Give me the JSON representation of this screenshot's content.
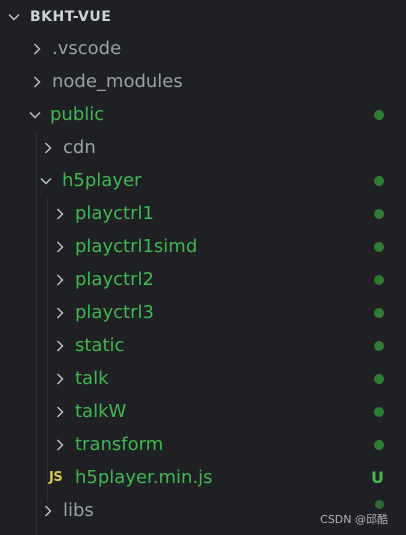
{
  "explorer": {
    "root": {
      "label": "BKHT-VUE"
    },
    "items": [
      {
        "label": ".vscode",
        "color": "#9aa0a6"
      },
      {
        "label": "node_modules",
        "color": "#9aa0a6"
      },
      {
        "label": "public",
        "color": "#3fb950"
      },
      {
        "label": "cdn",
        "color": "#9aa0a6"
      },
      {
        "label": "h5player",
        "color": "#3fb950"
      },
      {
        "label": "playctrl1",
        "color": "#3fb950"
      },
      {
        "label": "playctrl1simd",
        "color": "#3fb950"
      },
      {
        "label": "playctrl2",
        "color": "#3fb950"
      },
      {
        "label": "playctrl3",
        "color": "#3fb950"
      },
      {
        "label": "static",
        "color": "#3fb950"
      },
      {
        "label": "talk",
        "color": "#3fb950"
      },
      {
        "label": "talkW",
        "color": "#3fb950"
      },
      {
        "label": "transform",
        "color": "#3fb950"
      },
      {
        "label": "h5player.min.js",
        "color": "#3fb950",
        "icon": "JS",
        "badge": "U"
      },
      {
        "label": "libs",
        "color": "#9aa0a6"
      }
    ]
  },
  "watermark": "CSDN @邱酷"
}
